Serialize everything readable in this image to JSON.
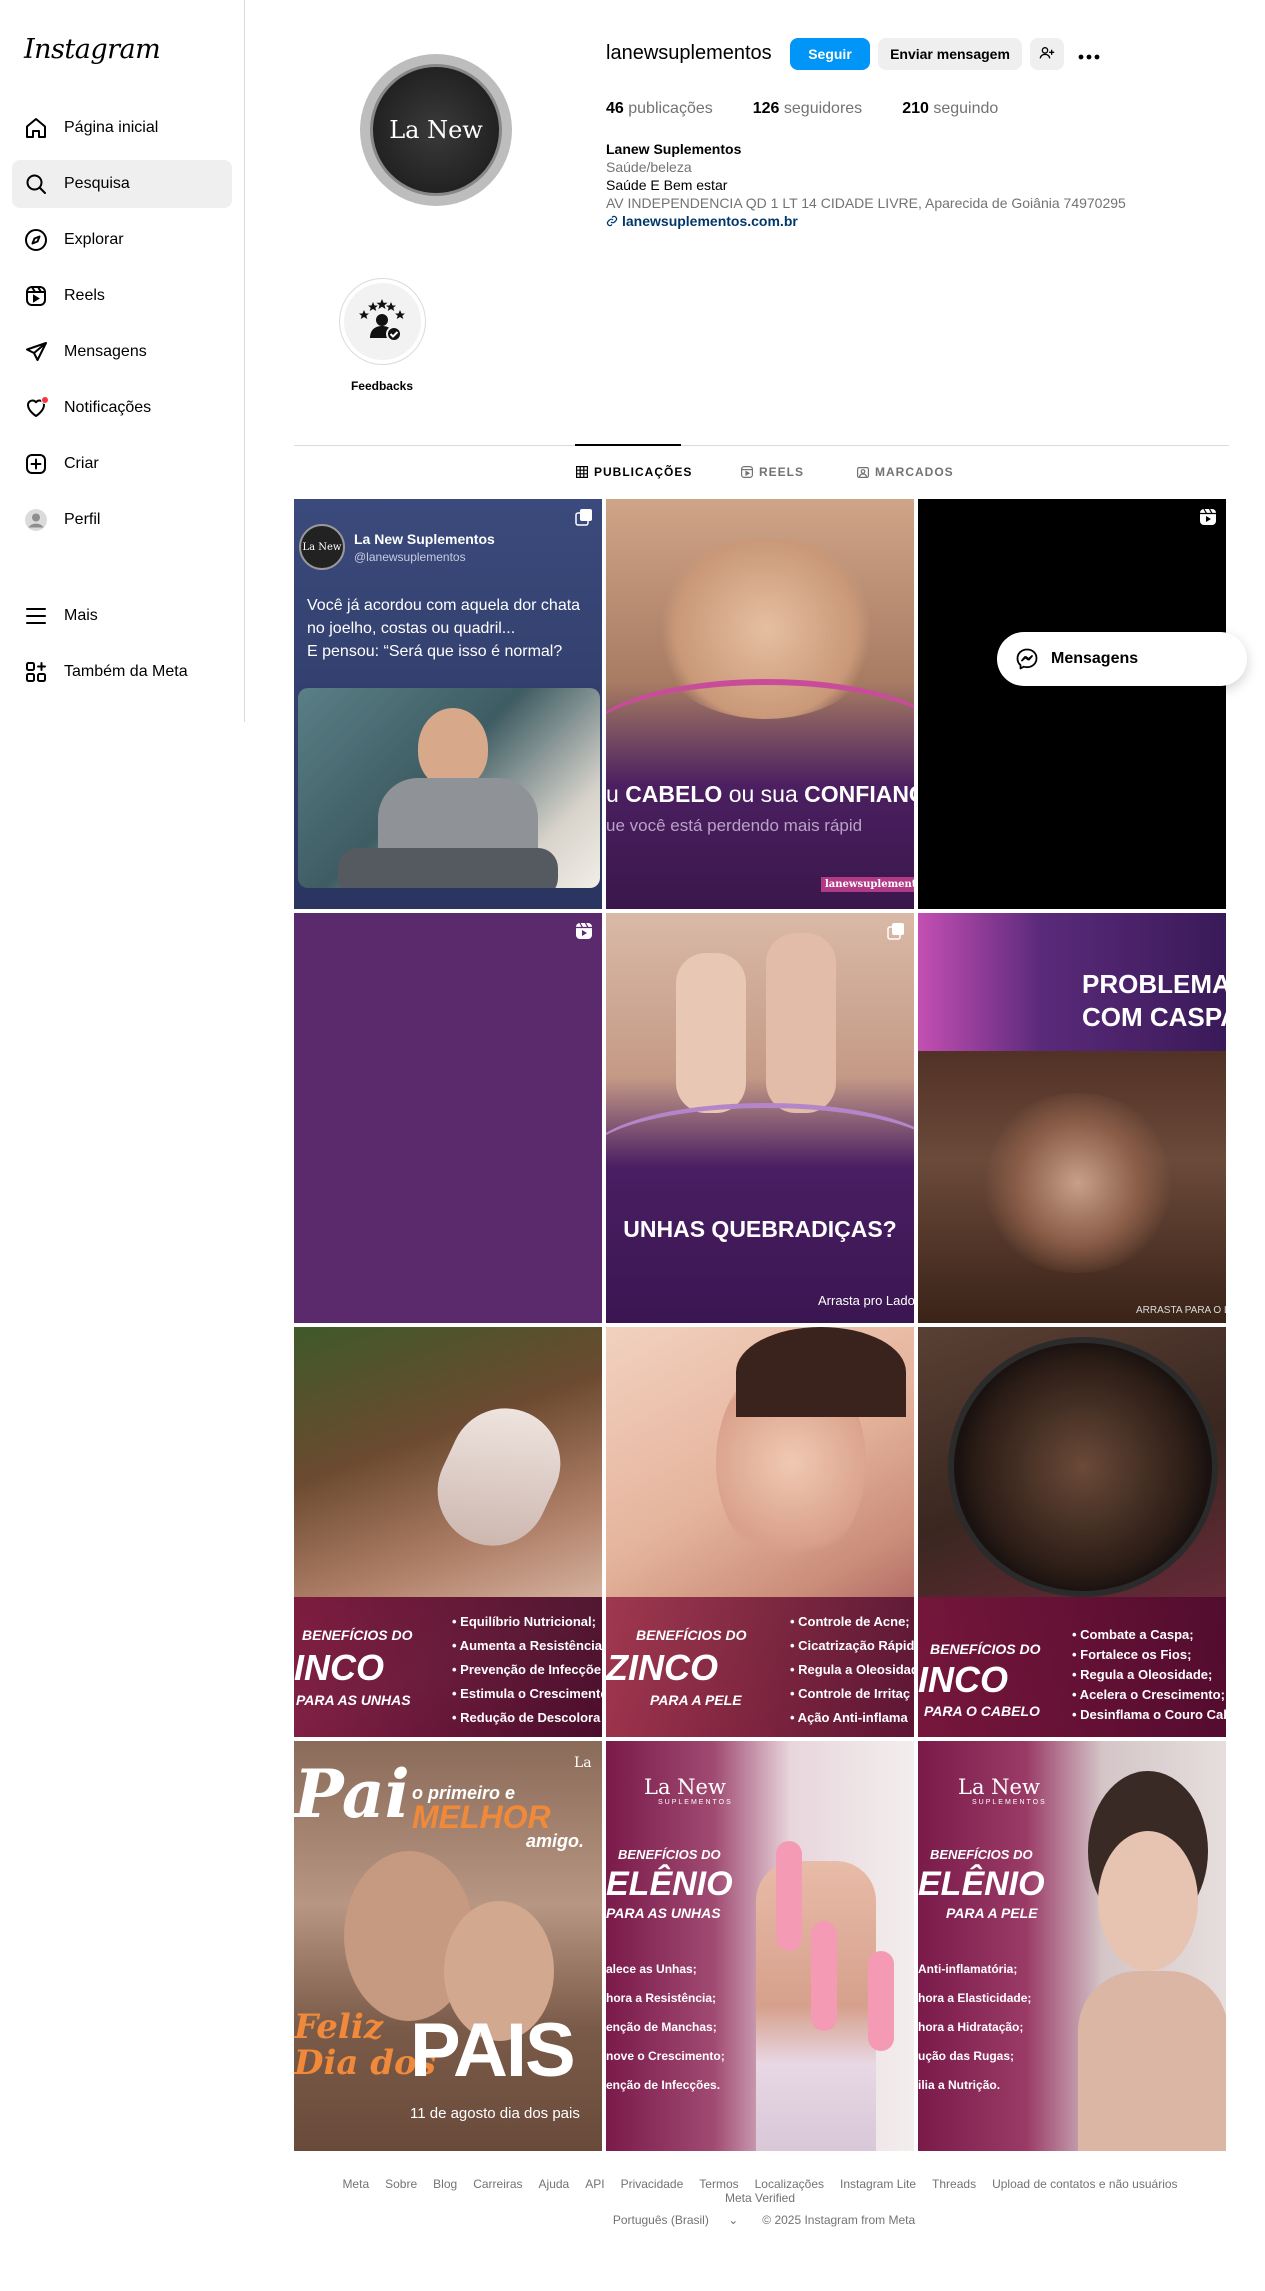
{
  "app": {
    "logo": "Instagram"
  },
  "sidebar": {
    "items": [
      {
        "label": "Página inicial",
        "icon": "home-icon"
      },
      {
        "label": "Pesquisa",
        "icon": "search-icon"
      },
      {
        "label": "Explorar",
        "icon": "compass-icon"
      },
      {
        "label": "Reels",
        "icon": "reels-icon"
      },
      {
        "label": "Mensagens",
        "icon": "send-icon"
      },
      {
        "label": "Notificações",
        "icon": "heart-icon"
      },
      {
        "label": "Criar",
        "icon": "plus-square-icon"
      },
      {
        "label": "Perfil",
        "icon": "avatar-icon"
      }
    ],
    "bottom_items": [
      {
        "label": "Mais",
        "icon": "menu-icon"
      },
      {
        "label": "Também da Meta",
        "icon": "meta-apps-icon"
      }
    ],
    "active": "Pesquisa"
  },
  "profile": {
    "avatar_text": "La New",
    "username": "lanewsuplementos",
    "follow_label": "Seguir",
    "message_label": "Enviar mensagem",
    "stats": {
      "posts_num": "46",
      "posts_label": "publicações",
      "followers_num": "126",
      "followers_label": "seguidores",
      "following_num": "210",
      "following_label": "seguindo"
    },
    "bio": {
      "name": "Lanew Suplementos",
      "category": "Saúde/beleza",
      "line1": "Saúde E Bem estar",
      "line2": "AV INDEPENDENCIA QD 1 LT 14 CIDADE LIVRE, Aparecida de Goiânia 74970295",
      "link": "lanewsuplementos.com.br"
    }
  },
  "highlights": [
    {
      "label": "Feedbacks"
    }
  ],
  "tabs": [
    {
      "label": "PUBLICAÇÕES",
      "active": true
    },
    {
      "label": "REELS",
      "active": false
    },
    {
      "label": "MARCADOS",
      "active": false
    }
  ],
  "posts": {
    "p1": {
      "account": "La New Suplementos",
      "handle": "@lanewsuplementos",
      "text1": "Você já acordou com aquela dor chata",
      "text2": "no joelho, costas ou quadril...",
      "text3": "E pensou: “Será que isso é normal?"
    },
    "p2": {
      "headline_a": "u ",
      "headline_b": "CABELO",
      "headline_c": " ou sua ",
      "headline_d": "CONFIANÇ",
      "sub": "ue você está perdendo mais rápid",
      "url": "lanewsuplementos.co"
    },
    "p5": {
      "headline": "UNHAS QUEBRADIÇAS?",
      "footer": "Arrasta pro Lado"
    },
    "p6": {
      "headline1": "PROBLEMAS",
      "headline2": "COM CASPA",
      "footer": "ARRASTA PARA O L"
    },
    "p7": {
      "benefit": "BENEFÍCIOS DO",
      "mineral": "INCO",
      "target": "PARA AS UNHAS",
      "list": [
        "• Equilíbrio Nutricional;",
        "• Aumenta a Resistência",
        "• Prevenção de Infecçõe",
        "• Estimula o Crescimento",
        "• Redução de Descolora"
      ]
    },
    "p8": {
      "benefit": "BENEFÍCIOS DO",
      "mineral": "ZINCO",
      "target": "PARA A PELE",
      "list": [
        "• Controle de Acne;",
        "• Cicatrização Rápid",
        "• Regula a Oleosidad",
        "• Controle de Irritaç",
        "• Ação Anti-inflama"
      ]
    },
    "p9": {
      "benefit": "BENEFÍCIOS DO",
      "mineral": "INCO",
      "target": "PARA O CABELO",
      "list": [
        "• Combate a Caspa;",
        "• Fortalece os Fios;",
        "• Regula a Oleosidade;",
        "• Acelera o Crescimento;",
        "• Desinflama o Couro Cab"
      ]
    },
    "p10": {
      "logo": "La",
      "pai": "Pai",
      "sub1": "o primeiro e",
      "sub2": "MELHOR",
      "sub3": "amigo.",
      "feliz1": "Feliz",
      "feliz2": "Dia dos",
      "pais": "PAIS",
      "date": "11 de agosto dia dos pais"
    },
    "p11": {
      "logo": "La New",
      "logo_sub": "SUPLEMENTOS",
      "benefit": "BENEFÍCIOS DO",
      "mineral": "ELÊNIO",
      "target": "PARA AS UNHAS",
      "list": [
        "alece as Unhas;",
        "hora a Resistência;",
        "enção de Manchas;",
        "nove o Crescimento;",
        "enção de Infecções."
      ]
    },
    "p12": {
      "logo": "La New",
      "logo_sub": "SUPLEMENTOS",
      "benefit": "BENEFÍCIOS DO",
      "mineral": "ELÊNIO",
      "target": "PARA A PELE",
      "list": [
        "Anti-inflamatória;",
        "hora a Elasticidade;",
        "hora a Hidratação;",
        "ução das Rugas;",
        "ilia a Nutrição."
      ]
    }
  },
  "floating": {
    "label": "Mensagens"
  },
  "footer": {
    "links": [
      "Meta",
      "Sobre",
      "Blog",
      "Carreiras",
      "Ajuda",
      "API",
      "Privacidade",
      "Termos",
      "Localizações",
      "Instagram Lite",
      "Threads",
      "Upload de contatos e não usuários",
      "Meta Verified"
    ],
    "language": "Português (Brasil)",
    "copyright": "© 2025 Instagram from Meta"
  },
  "colors": {
    "accent": "#0095f6",
    "purple": "#4a1f5e",
    "notif": "#ff3040"
  }
}
